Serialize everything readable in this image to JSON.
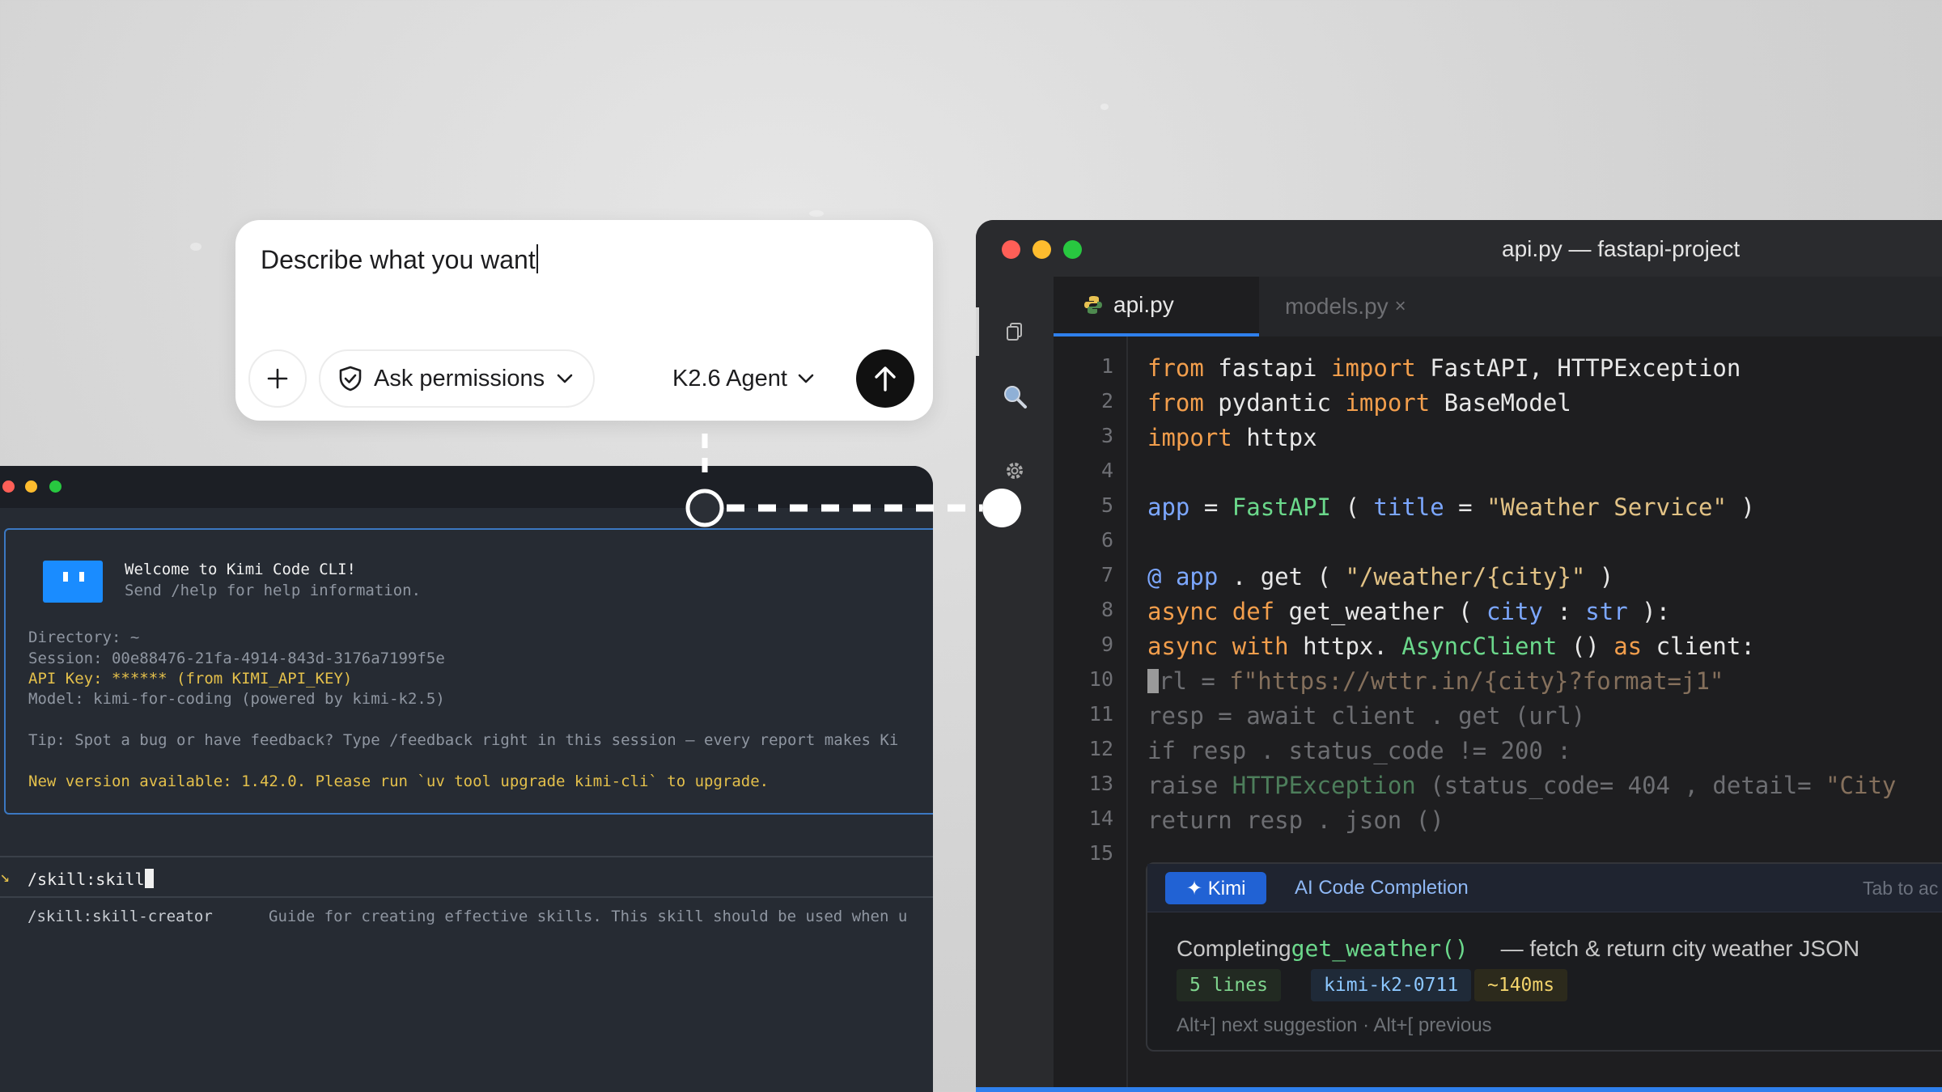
{
  "prompt": {
    "input_value": "Describe what you want",
    "permissions_label": "Ask permissions",
    "model_label": "K2.6 Agent"
  },
  "terminal": {
    "welcome_title": "Welcome to Kimi Code CLI!",
    "welcome_sub": "Send /help for help information.",
    "directory": "Directory: ~",
    "session": "Session: 00e88476-21fa-4914-843d-3176a7199f5e",
    "api_key": "API Key: ****** (from KIMI_API_KEY)",
    "model": "Model: kimi-for-coding (powered by kimi-k2.5)",
    "tip": "Tip: Spot a bug or have feedback? Type /feedback right in this session — every report makes Ki",
    "update": "New version available: 1.42.0. Please run `uv tool upgrade kimi-cli` to upgrade.",
    "command": "/skill:skill",
    "suggestion_name": "/skill:skill-creator",
    "suggestion_desc": "Guide for creating effective skills. This skill should be used when u"
  },
  "editor": {
    "window_title": "api.py — fastapi-project",
    "tabs": [
      {
        "label": "api.py",
        "active": true
      },
      {
        "label": "models.py",
        "active": false
      }
    ],
    "line_numbers": [
      "1",
      "2",
      "3",
      "4",
      "5",
      "6",
      "7",
      "8",
      "9",
      "10",
      "11",
      "12",
      "13",
      "14",
      "15"
    ],
    "completion": {
      "badge": "✦ Kimi",
      "title": "AI Code Completion",
      "hint": "Tab to ac",
      "completing": "Completing",
      "function": "get_weather()",
      "description": "— fetch & return city weather JSON",
      "chips": [
        "5 lines",
        "kimi-k2-0711",
        "~140ms"
      ],
      "footer": "Alt+] next suggestion · Alt+[ previous"
    }
  },
  "colors": {
    "accent": "#2f80ed",
    "keyword": "#f29e4c",
    "class": "#6bd88b",
    "string": "#e2c285",
    "terminal_warn": "#e4c04b"
  },
  "icons": [
    "plus-icon",
    "shield-check-icon",
    "chevron-down-icon",
    "arrow-up-icon",
    "files-icon",
    "search-icon",
    "gear-icon",
    "python-icon",
    "close-icon",
    "kimi-logo"
  ]
}
